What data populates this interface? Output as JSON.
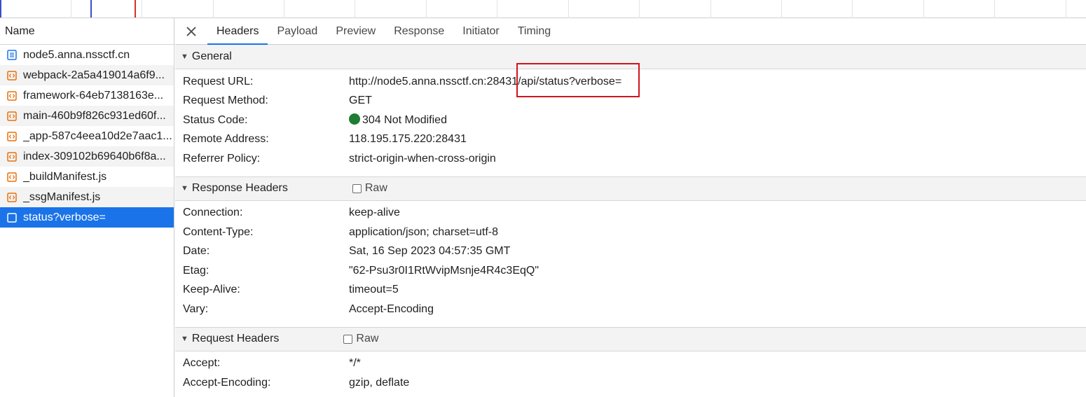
{
  "colors": {
    "accent": "#1a73e8",
    "selected_row_bg": "#1a73e8",
    "status_ok": "#1e7d32",
    "annotation_box": "#d0141e",
    "timeline_blue": "#3b4fc8",
    "timeline_red": "#d93025"
  },
  "requests_panel": {
    "column_header": "Name",
    "items": [
      {
        "name": "node5.anna.nssctf.cn",
        "icon": "document-icon",
        "selected": false
      },
      {
        "name": "webpack-2a5a419014a6f9...",
        "icon": "script-icon",
        "selected": false
      },
      {
        "name": "framework-64eb7138163e...",
        "icon": "script-icon",
        "selected": false
      },
      {
        "name": "main-460b9f826c931ed60f...",
        "icon": "script-icon",
        "selected": false
      },
      {
        "name": "_app-587c4eea10d2e7aac1...",
        "icon": "script-icon",
        "selected": false
      },
      {
        "name": "index-309102b69640b6f8a...",
        "icon": "script-icon",
        "selected": false
      },
      {
        "name": "_buildManifest.js",
        "icon": "script-icon",
        "selected": false
      },
      {
        "name": "_ssgManifest.js",
        "icon": "script-icon",
        "selected": false
      },
      {
        "name": "status?verbose=",
        "icon": "fetch-icon",
        "selected": true
      }
    ]
  },
  "details": {
    "close_icon": "close-icon",
    "tabs": [
      {
        "label": "Headers",
        "active": true
      },
      {
        "label": "Payload",
        "active": false
      },
      {
        "label": "Preview",
        "active": false
      },
      {
        "label": "Response",
        "active": false
      },
      {
        "label": "Initiator",
        "active": false
      },
      {
        "label": "Timing",
        "active": false
      }
    ],
    "general": {
      "title": "General",
      "rows": [
        {
          "key": "Request URL:",
          "value_part1": "http://node5.anna.nssctf.cn:2843",
          "value_part2": "1/api/status?verbose="
        },
        {
          "key": "Request Method:",
          "value": "GET"
        },
        {
          "key": "Status Code:",
          "value": "304 Not Modified"
        },
        {
          "key": "Remote Address:",
          "value": "118.195.175.220:28431"
        },
        {
          "key": "Referrer Policy:",
          "value": "strict-origin-when-cross-origin"
        }
      ]
    },
    "response_headers": {
      "title": "Response Headers",
      "raw_label": "Raw",
      "rows": [
        {
          "key": "Connection:",
          "value": "keep-alive"
        },
        {
          "key": "Content-Type:",
          "value": "application/json; charset=utf-8"
        },
        {
          "key": "Date:",
          "value": "Sat, 16 Sep 2023 04:57:35 GMT"
        },
        {
          "key": "Etag:",
          "value": "\"62-Psu3r0I1RtWvipMsnje4R4c3EqQ\""
        },
        {
          "key": "Keep-Alive:",
          "value": "timeout=5"
        },
        {
          "key": "Vary:",
          "value": "Accept-Encoding"
        }
      ]
    },
    "request_headers": {
      "title": "Request Headers",
      "raw_label": "Raw",
      "rows": [
        {
          "key": "Accept:",
          "value": "*/*"
        },
        {
          "key": "Accept-Encoding:",
          "value": "gzip, deflate"
        }
      ]
    }
  }
}
